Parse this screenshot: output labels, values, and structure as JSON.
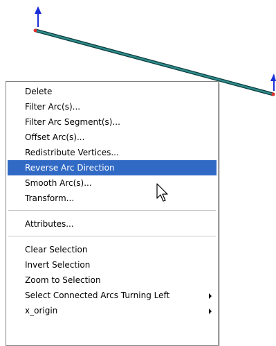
{
  "canvas": {
    "arc_color": "#2e8b8b",
    "arc_outline_color": "#0d3b3b",
    "vertex_color": "#e03030",
    "direction_arrow_color": "#1a2fd8"
  },
  "context_menu": {
    "items": [
      {
        "label": "Delete",
        "highlighted": false,
        "submenu": false
      },
      {
        "label": "Filter Arc(s)...",
        "highlighted": false,
        "submenu": false
      },
      {
        "label": "Filter Arc Segment(s)...",
        "highlighted": false,
        "submenu": false
      },
      {
        "label": "Offset Arc(s)...",
        "highlighted": false,
        "submenu": false
      },
      {
        "label": "Redistribute Vertices...",
        "highlighted": false,
        "submenu": false
      },
      {
        "label": "Reverse Arc Direction",
        "highlighted": true,
        "submenu": false
      },
      {
        "label": "Smooth Arc(s)...",
        "highlighted": false,
        "submenu": false
      },
      {
        "label": "Transform...",
        "highlighted": false,
        "submenu": false
      },
      {
        "label": "Attributes...",
        "highlighted": false,
        "submenu": false
      },
      {
        "label": "Clear Selection",
        "highlighted": false,
        "submenu": false
      },
      {
        "label": "Invert Selection",
        "highlighted": false,
        "submenu": false
      },
      {
        "label": "Zoom to Selection",
        "highlighted": false,
        "submenu": false
      },
      {
        "label": "Select Connected Arcs Turning Left",
        "highlighted": false,
        "submenu": true
      },
      {
        "label": "x_origin",
        "highlighted": false,
        "submenu": true
      }
    ],
    "highlight_color": "#316ac5"
  },
  "cursor": {
    "icon": "arrow-pointer-icon"
  }
}
